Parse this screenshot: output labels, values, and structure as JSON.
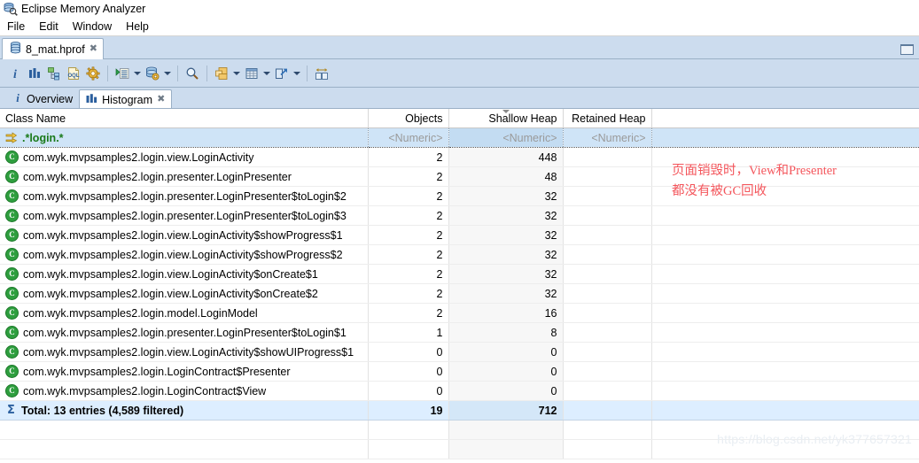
{
  "window": {
    "title": "Eclipse Memory Analyzer",
    "app_icon": "memory-analyzer-icon",
    "restore_icon": "restore-window-icon"
  },
  "menubar": {
    "items": [
      {
        "label": "File"
      },
      {
        "label": "Edit"
      },
      {
        "label": "Window"
      },
      {
        "label": "Help"
      }
    ]
  },
  "editor_tabs": [
    {
      "label": "8_mat.hprof",
      "icon": "heap-dump-icon",
      "close": "✖",
      "active": true
    }
  ],
  "toolbar": {
    "buttons": [
      {
        "name": "overview-info-button",
        "icon": "info-i-icon",
        "glyph": "i"
      },
      {
        "name": "histogram-button",
        "icon": "histogram-bars-icon"
      },
      {
        "name": "dominator-tree-button",
        "icon": "dominator-tree-icon"
      },
      {
        "name": "oql-button",
        "icon": "oql-document-icon",
        "glyph": "OQL"
      },
      {
        "name": "inspector-button",
        "icon": "gear-icon"
      },
      {
        "name": "open-query-browser-button",
        "icon": "query-list-icon",
        "has_arrow": true
      },
      {
        "name": "run-expert-system-button",
        "icon": "heap-gear-icon",
        "has_arrow": true
      },
      {
        "name": "find-button",
        "icon": "magnifier-icon"
      },
      {
        "name": "group-by-button",
        "icon": "group-folders-icon",
        "has_arrow": true
      },
      {
        "name": "calculate-retained-size-button",
        "icon": "table-calc-icon",
        "has_arrow": true
      },
      {
        "name": "export-button",
        "icon": "export-arrow-icon",
        "has_arrow": true
      },
      {
        "name": "compare-button",
        "icon": "compare-panels-icon"
      }
    ]
  },
  "view_tabs": [
    {
      "label": "Overview",
      "icon": "info-i-icon",
      "active": false,
      "closable": false
    },
    {
      "label": "Histogram",
      "icon": "histogram-bars-icon",
      "active": true,
      "closable": true,
      "close": "✖"
    }
  ],
  "table": {
    "columns": [
      {
        "key": "class_name",
        "label": "Class Name",
        "align": "left",
        "sorted": false
      },
      {
        "key": "objects",
        "label": "Objects",
        "align": "right",
        "sorted": false
      },
      {
        "key": "shallow_heap",
        "label": "Shallow Heap",
        "align": "right",
        "sorted": true,
        "sort_dir": "desc"
      },
      {
        "key": "retained_heap",
        "label": "Retained Heap",
        "align": "right",
        "sorted": false
      }
    ],
    "filter_row": {
      "icon": "filter-arrows-icon",
      "class_name": ".*login.*",
      "objects": "<Numeric>",
      "shallow_heap": "<Numeric>",
      "retained_heap": "<Numeric>"
    },
    "rows": [
      {
        "icon": "class-icon",
        "class_name": "com.wyk.mvpsamples2.login.view.LoginActivity",
        "objects": "2",
        "shallow_heap": "448",
        "retained_heap": ""
      },
      {
        "icon": "class-icon",
        "class_name": "com.wyk.mvpsamples2.login.presenter.LoginPresenter",
        "objects": "2",
        "shallow_heap": "48",
        "retained_heap": ""
      },
      {
        "icon": "class-icon",
        "class_name": "com.wyk.mvpsamples2.login.presenter.LoginPresenter$toLogin$2",
        "objects": "2",
        "shallow_heap": "32",
        "retained_heap": ""
      },
      {
        "icon": "class-icon",
        "class_name": "com.wyk.mvpsamples2.login.presenter.LoginPresenter$toLogin$3",
        "objects": "2",
        "shallow_heap": "32",
        "retained_heap": ""
      },
      {
        "icon": "class-icon",
        "class_name": "com.wyk.mvpsamples2.login.view.LoginActivity$showProgress$1",
        "objects": "2",
        "shallow_heap": "32",
        "retained_heap": ""
      },
      {
        "icon": "class-icon",
        "class_name": "com.wyk.mvpsamples2.login.view.LoginActivity$showProgress$2",
        "objects": "2",
        "shallow_heap": "32",
        "retained_heap": ""
      },
      {
        "icon": "class-icon",
        "class_name": "com.wyk.mvpsamples2.login.view.LoginActivity$onCreate$1",
        "objects": "2",
        "shallow_heap": "32",
        "retained_heap": ""
      },
      {
        "icon": "class-icon",
        "class_name": "com.wyk.mvpsamples2.login.view.LoginActivity$onCreate$2",
        "objects": "2",
        "shallow_heap": "32",
        "retained_heap": ""
      },
      {
        "icon": "class-icon",
        "class_name": "com.wyk.mvpsamples2.login.model.LoginModel",
        "objects": "2",
        "shallow_heap": "16",
        "retained_heap": ""
      },
      {
        "icon": "class-icon",
        "class_name": "com.wyk.mvpsamples2.login.presenter.LoginPresenter$toLogin$1",
        "objects": "1",
        "shallow_heap": "8",
        "retained_heap": ""
      },
      {
        "icon": "class-icon",
        "class_name": "com.wyk.mvpsamples2.login.view.LoginActivity$showUIProgress$1",
        "objects": "0",
        "shallow_heap": "0",
        "retained_heap": ""
      },
      {
        "icon": "class-icon",
        "class_name": "com.wyk.mvpsamples2.login.LoginContract$Presenter",
        "objects": "0",
        "shallow_heap": "0",
        "retained_heap": ""
      },
      {
        "icon": "class-icon",
        "class_name": "com.wyk.mvpsamples2.login.LoginContract$View",
        "objects": "0",
        "shallow_heap": "0",
        "retained_heap": ""
      }
    ],
    "total_row": {
      "icon": "sigma-icon",
      "label": "Total: 13 entries (4,589 filtered)",
      "objects": "19",
      "shallow_heap": "712",
      "retained_heap": ""
    }
  },
  "annotation": {
    "line1": "页面销毁时，View和Presenter",
    "line2": "都没有被GC回收",
    "color": "#f4565c"
  },
  "watermark": {
    "text": "https://blog.csdn.net/yk377657321"
  },
  "colors": {
    "toolbar_bg": "#ccdcee",
    "selection_bg": "#cfe4f7",
    "total_bg": "#ddeeff",
    "sorted_col_bg": "#f7f7f7",
    "filter_text": "#1a7a1a",
    "annotation": "#f4565c"
  }
}
